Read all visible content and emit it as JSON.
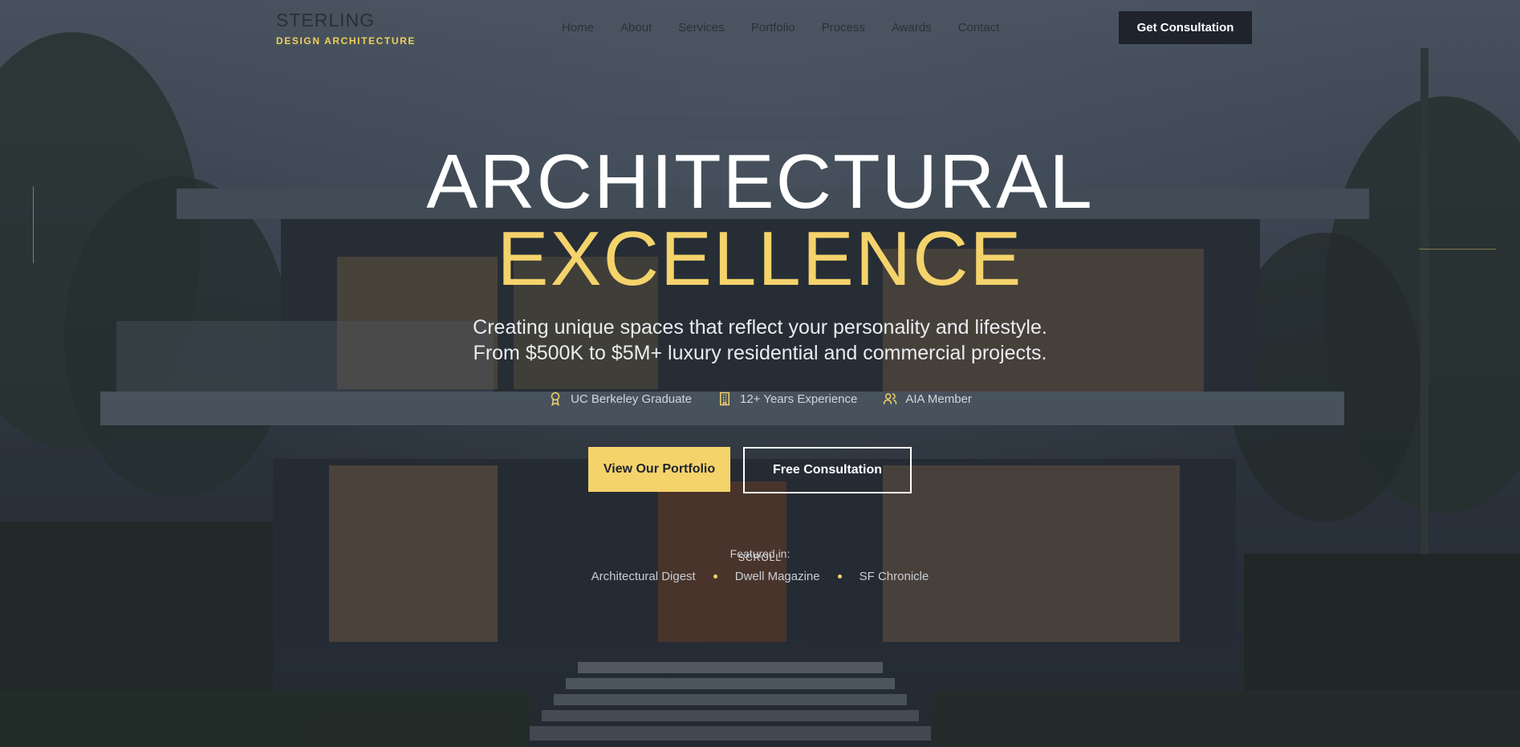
{
  "brand": {
    "name": "STERLING",
    "tagline": "DESIGN ARCHITECTURE"
  },
  "nav": {
    "links": [
      "Home",
      "About",
      "Services",
      "Portfolio",
      "Process",
      "Awards",
      "Contact"
    ],
    "cta": "Get Consultation"
  },
  "hero": {
    "title_line1": "ARCHITECTURAL",
    "title_line2": "EXCELLENCE",
    "subtitle_line1": "Creating unique spaces that reflect your personality and lifestyle.",
    "subtitle_line2": "From $500K to $5M+ luxury residential and commercial projects.",
    "credentials": [
      {
        "icon": "award-icon",
        "label": "UC Berkeley Graduate"
      },
      {
        "icon": "building-icon",
        "label": "12+ Years Experience"
      },
      {
        "icon": "users-icon",
        "label": "AIA Member"
      }
    ],
    "primary_button": "View Our Portfolio",
    "secondary_button": "Free Consultation",
    "featured_label": "Featured in:",
    "scroll_label": "SCROLL",
    "featured": [
      "Architectural Digest",
      "Dwell Magazine",
      "SF Chronicle"
    ]
  },
  "colors": {
    "accent": "#f4d36b",
    "dark": "#1f242c",
    "text_light": "#ffffff"
  }
}
